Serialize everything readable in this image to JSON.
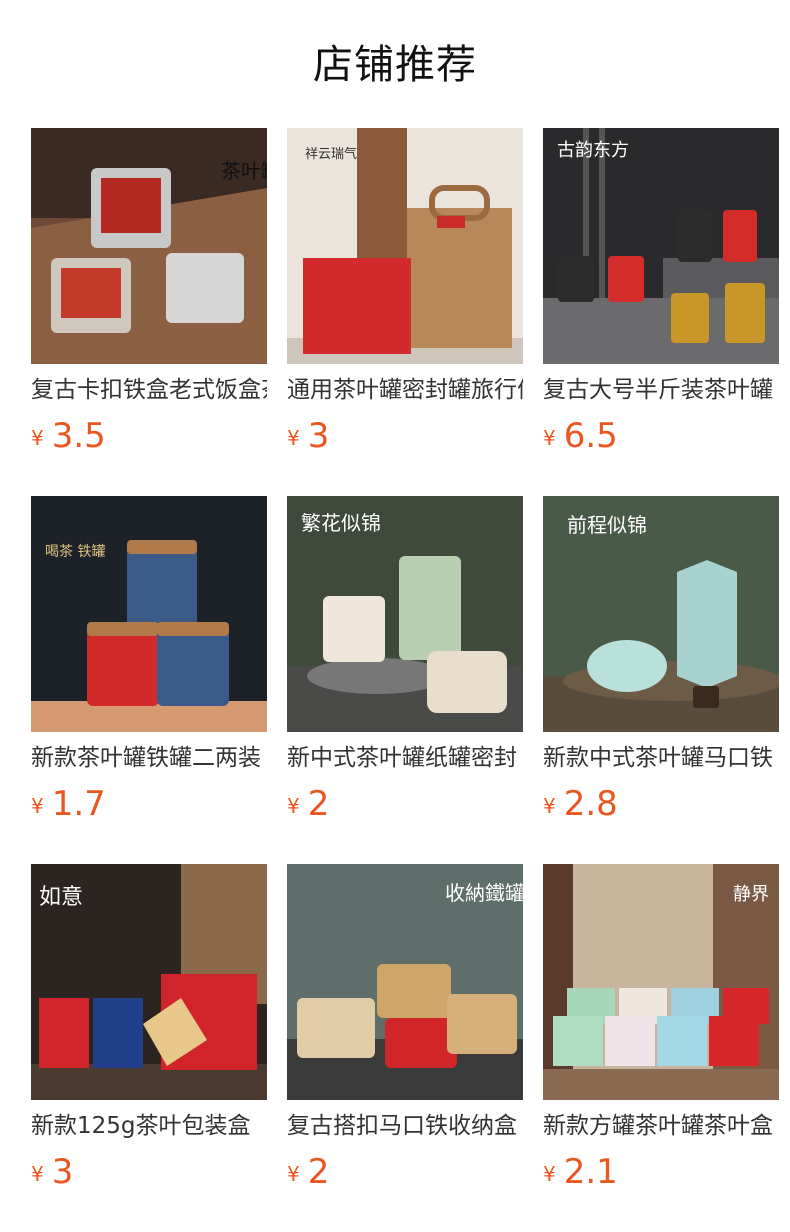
{
  "section": {
    "title": "店铺推荐"
  },
  "currency_symbol": "¥",
  "products": [
    {
      "name": "复古卡扣铁盒老式饭盒茶叶罐",
      "price": "3.5",
      "image_text": "茶叶罐"
    },
    {
      "name": "通用茶叶罐密封罐旅行便携",
      "price": "3",
      "image_text": "祥云瑞气"
    },
    {
      "name": "复古大号半斤装茶叶罐",
      "price": "6.5",
      "image_text": "古韵东方"
    },
    {
      "name": "新款茶叶罐铁罐二两装",
      "price": "1.7",
      "image_text": "喝茶 铁罐"
    },
    {
      "name": "新中式茶叶罐纸罐密封",
      "price": "2",
      "image_text": "繁花似锦"
    },
    {
      "name": "新款中式茶叶罐马口铁",
      "price": "2.8",
      "image_text": "前程似锦"
    },
    {
      "name": "新款125g茶叶包装盒",
      "price": "3",
      "image_text": "如意"
    },
    {
      "name": "复古搭扣马口铁收纳盒",
      "price": "2",
      "image_text": "收納鐵罐"
    },
    {
      "name": "新款方罐茶叶罐茶叶盒",
      "price": "2.1",
      "image_text": "静界"
    }
  ]
}
